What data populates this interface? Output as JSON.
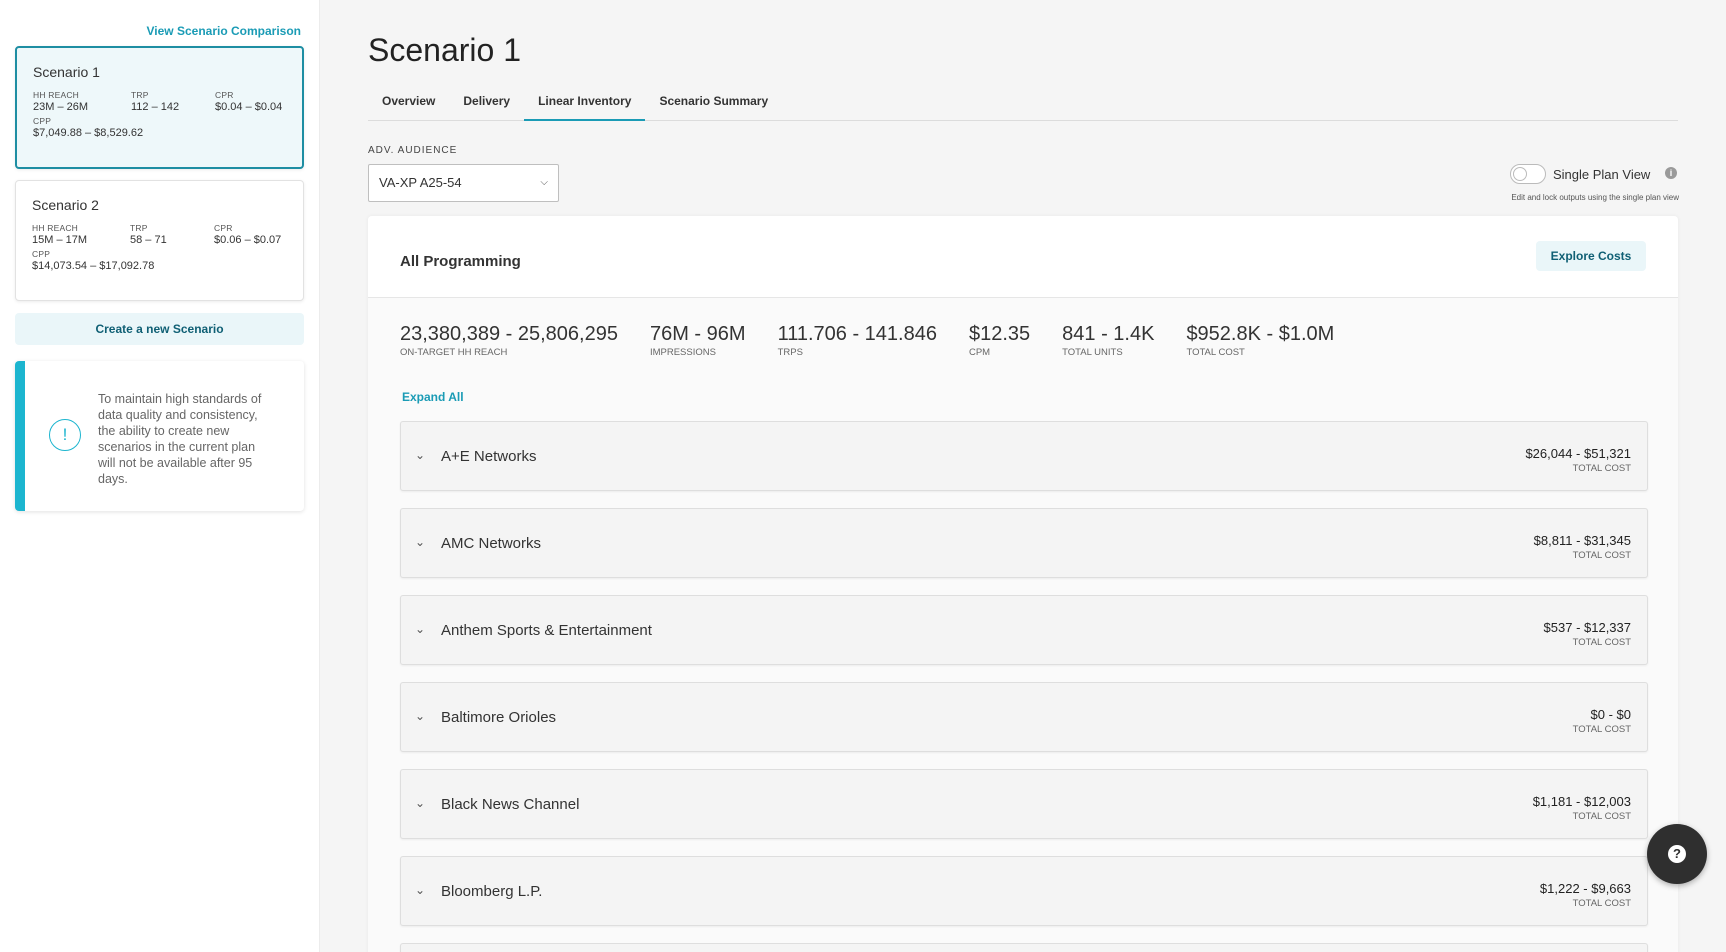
{
  "sidebar": {
    "compare_link": "View Scenario Comparison",
    "scenarios": [
      {
        "title": "Scenario 1",
        "hh_reach_label": "HH REACH",
        "hh_reach": "23M – 26M",
        "trp_label": "TRP",
        "trp": "112 – 142",
        "cpr_label": "CPR",
        "cpr": "$0.04 – $0.04",
        "cpp_label": "CPP",
        "cpp": "$7,049.88 – $8,529.62"
      },
      {
        "title": "Scenario 2",
        "hh_reach_label": "HH REACH",
        "hh_reach": "15M – 17M",
        "trp_label": "TRP",
        "trp": "58 – 71",
        "cpr_label": "CPR",
        "cpr": "$0.06 – $0.07",
        "cpp_label": "CPP",
        "cpp": "$14,073.54 – $17,092.78"
      }
    ],
    "create_button": "Create a new Scenario",
    "notice": {
      "icon": "!",
      "text": "To maintain high standards of data quality and consistency, the ability to create new scenarios in the current plan will not be available after 95 days."
    }
  },
  "main": {
    "title": "Scenario 1",
    "tabs": [
      "Overview",
      "Delivery",
      "Linear Inventory",
      "Scenario Summary"
    ],
    "active_tab": "Linear Inventory",
    "audience_label": "ADV. AUDIENCE",
    "audience_value": "VA-XP A25-54",
    "single_plan_view": {
      "label": "Single Plan View",
      "enabled": false,
      "subtext": "Edit and lock outputs using the single plan view"
    },
    "panel": {
      "title": "All Programming",
      "explore_button": "Explore Costs",
      "stats": [
        {
          "value": "23,380,389 - 25,806,295",
          "label": "ON-TARGET HH REACH"
        },
        {
          "value": "76M - 96M",
          "label": "IMPRESSIONS"
        },
        {
          "value": "111.706 - 141.846",
          "label": "TRPS"
        },
        {
          "value": "$12.35",
          "label": "CPM"
        },
        {
          "value": "841 - 1.4K",
          "label": "TOTAL UNITS"
        },
        {
          "value": "$952.8K - $1.0M",
          "label": "TOTAL COST"
        }
      ],
      "expand_all": "Expand All",
      "networks": [
        {
          "name": "A+E Networks",
          "cost": "$26,044 - $51,321",
          "cost_label": "TOTAL COST"
        },
        {
          "name": "AMC Networks",
          "cost": "$8,811 - $31,345",
          "cost_label": "TOTAL COST"
        },
        {
          "name": "Anthem Sports & Entertainment",
          "cost": "$537 - $12,337",
          "cost_label": "TOTAL COST"
        },
        {
          "name": "Baltimore Orioles",
          "cost": "$0 - $0",
          "cost_label": "TOTAL COST"
        },
        {
          "name": "Black News Channel",
          "cost": "$1,181 - $12,003",
          "cost_label": "TOTAL COST"
        },
        {
          "name": "Bloomberg L.P.",
          "cost": "$1,222 - $9,663",
          "cost_label": "TOTAL COST"
        }
      ]
    }
  },
  "help_button": {
    "icon": "?"
  }
}
